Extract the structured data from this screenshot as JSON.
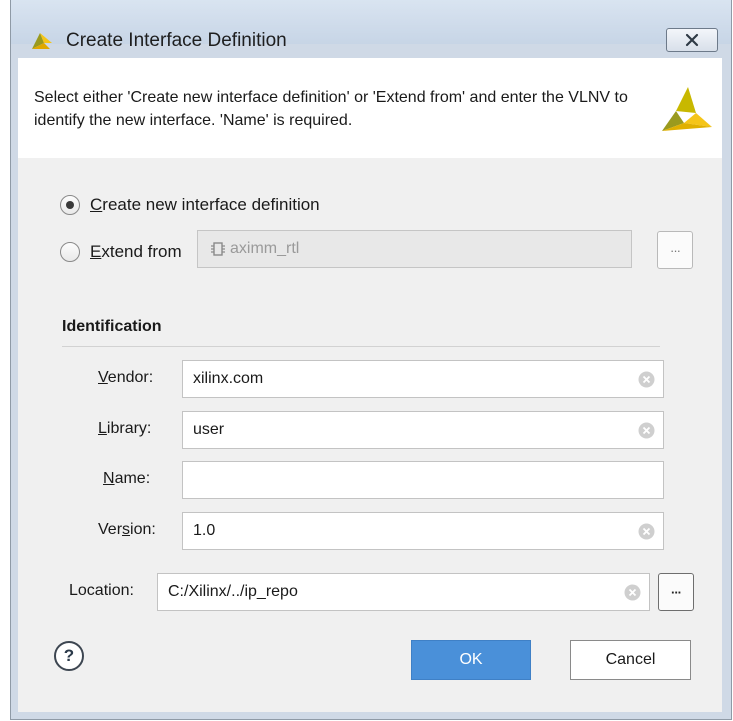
{
  "window": {
    "title": "Create Interface Definition",
    "close_icon": "close-x"
  },
  "header": {
    "description": "Select either 'Create new interface definition' or 'Extend from' and enter the VLNV to identify the new interface. 'Name' is required.",
    "logo_icon": "vivado-logo"
  },
  "mode": {
    "create_label_accel": "C",
    "create_label_rest": "reate new interface definition",
    "create_selected": true,
    "extend_label_accel": "E",
    "extend_label_rest": "xtend from",
    "extend_selected": false,
    "extend_value": "aximm_rtl",
    "extend_browse_label": "···"
  },
  "identification": {
    "title": "Identification",
    "vendor": {
      "label_accel": "V",
      "label_rest": "endor:",
      "value": "xilinx.com"
    },
    "library": {
      "label_accel": "L",
      "label_rest": "ibrary:",
      "value": "user"
    },
    "name": {
      "label_accel": "N",
      "label_rest": "ame:",
      "value": ""
    },
    "version": {
      "label_pre": "Ver",
      "label_accel": "s",
      "label_rest": "ion:",
      "value": "1.0"
    }
  },
  "location": {
    "label": "Location:",
    "value": "C:/Xilinx/../ip_repo",
    "browse_label": "···"
  },
  "buttons": {
    "help": "?",
    "ok": "OK",
    "cancel": "Cancel"
  },
  "colors": {
    "ok_button": "#4a90d9",
    "logo_yellow": "#f5c518",
    "logo_olive": "#9a9a1e"
  }
}
